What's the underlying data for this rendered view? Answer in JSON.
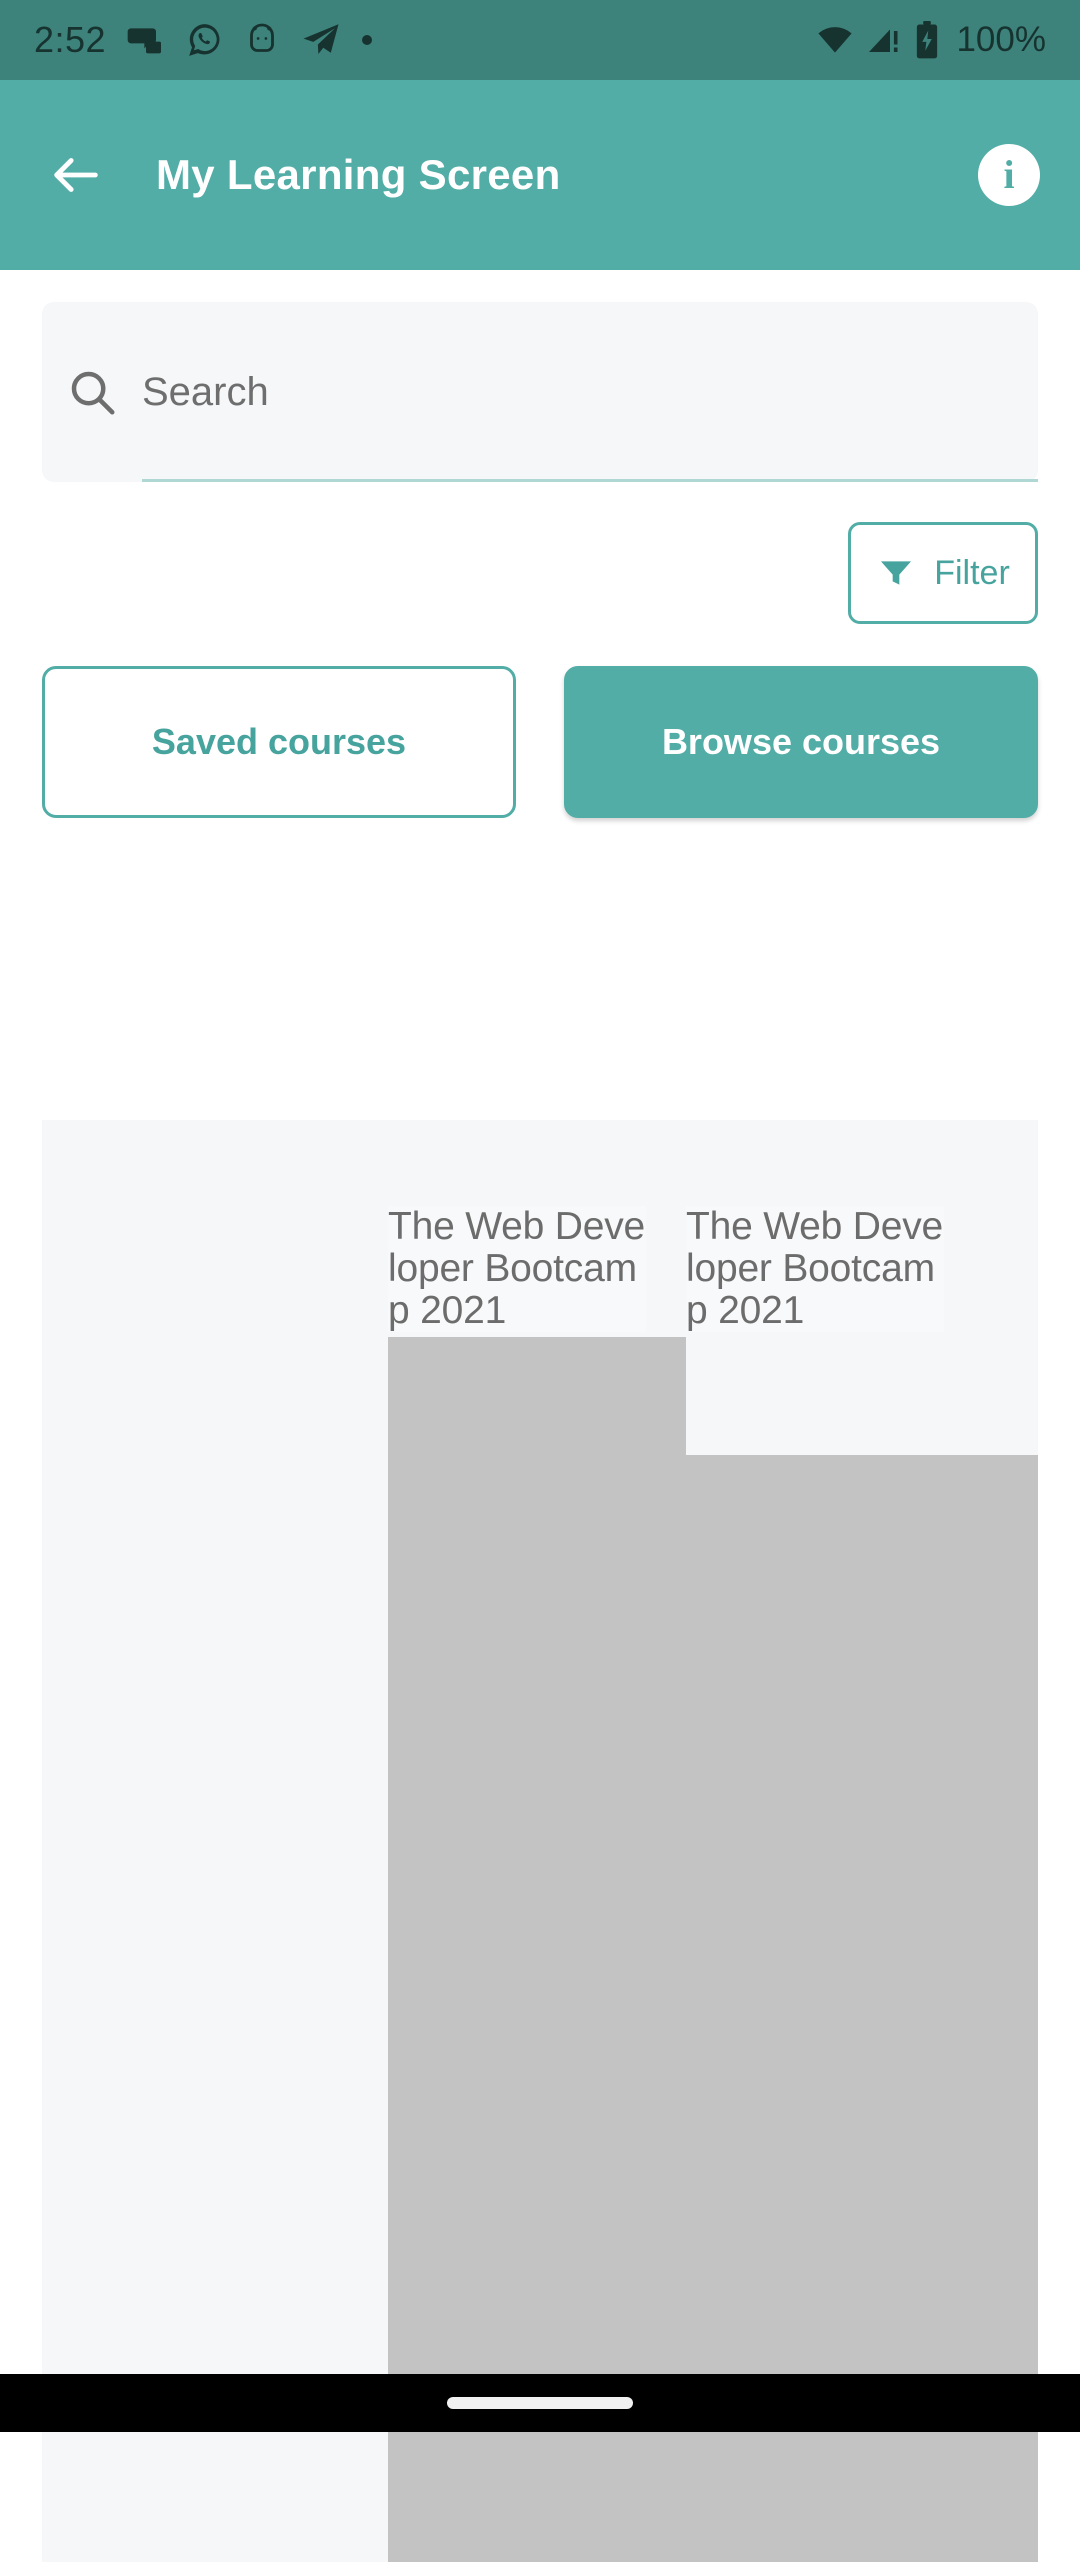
{
  "status_bar": {
    "time": "2:52",
    "battery_text": "100%",
    "icons": [
      "discord-icon",
      "whatsapp-icon",
      "android-bot-icon",
      "telegram-icon",
      "dot-icon"
    ],
    "right_icons": [
      "wifi-icon",
      "cellular-signal-icon",
      "battery-charging-icon"
    ],
    "background_color": "#3E827C"
  },
  "app_bar": {
    "title": "My Learning Screen",
    "back_icon": "arrow-left-icon",
    "info_icon": "info-icon",
    "info_glyph": "i",
    "background_color": "#52ADA7",
    "title_color": "#FFFFFF"
  },
  "search": {
    "placeholder": "Search",
    "value": "",
    "icon": "search-icon",
    "background_color": "#F5F7F9",
    "underline_color": "#AFD8D5"
  },
  "filter": {
    "label": "Filter",
    "icon": "filter-funnel-icon",
    "accent_color": "#46A39D"
  },
  "tabs": [
    {
      "label": "Saved courses",
      "active": false
    },
    {
      "label": "Browse courses",
      "active": true
    }
  ],
  "courses": [
    {
      "title": "The Web Developer Bootcamp 2021",
      "thumbnail": "image-placeholder"
    },
    {
      "title": "The Web Developer Bootcamp 2021",
      "thumbnail": "image-placeholder"
    }
  ],
  "course_area": {
    "background_color": "#F5F7F9",
    "placeholder_color": "#C3C3C3"
  },
  "nav_bar": {
    "home_indicator": "home-pill",
    "background_color": "#000000"
  }
}
